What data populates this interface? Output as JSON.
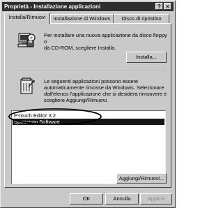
{
  "window": {
    "title": "Proprietà - Installazione applicazioni"
  },
  "titlebar_buttons": {
    "help": "?",
    "close": "×"
  },
  "tabs": [
    {
      "label": "Installa/Rimuovi",
      "active": true
    },
    {
      "label": "Installazione di Windows",
      "active": false
    },
    {
      "label": "Disco di ripristino",
      "active": false
    }
  ],
  "install_section": {
    "icon": "floppy-cd-install-icon",
    "text_line1": "Per installare una nuova applicazione da disco floppy o",
    "text_line2": "da CD-ROM, scegliere Installa.",
    "install_button": "Installa..."
  },
  "remove_section": {
    "icon": "uninstall-icon",
    "text_line1": "Le seguenti applicazioni possono essere",
    "text_line2": "automaticamente rimosse da Windows. Selezionare",
    "text_line3": "dall'elenco l'applicazione che si desidera rimuovere e",
    "text_line4": "scegliere Aggiungi/Rimuovi."
  },
  "applications": [
    {
      "name": "P-touch Editor 3.2",
      "selected": false
    },
    {
      "name": "Spotcrnap Software",
      "selected": true
    }
  ],
  "add_remove_button": "Aggiungi/Rimuovi...",
  "footer_buttons": {
    "ok": "OK",
    "cancel": "Annulla",
    "apply": "Applica"
  }
}
